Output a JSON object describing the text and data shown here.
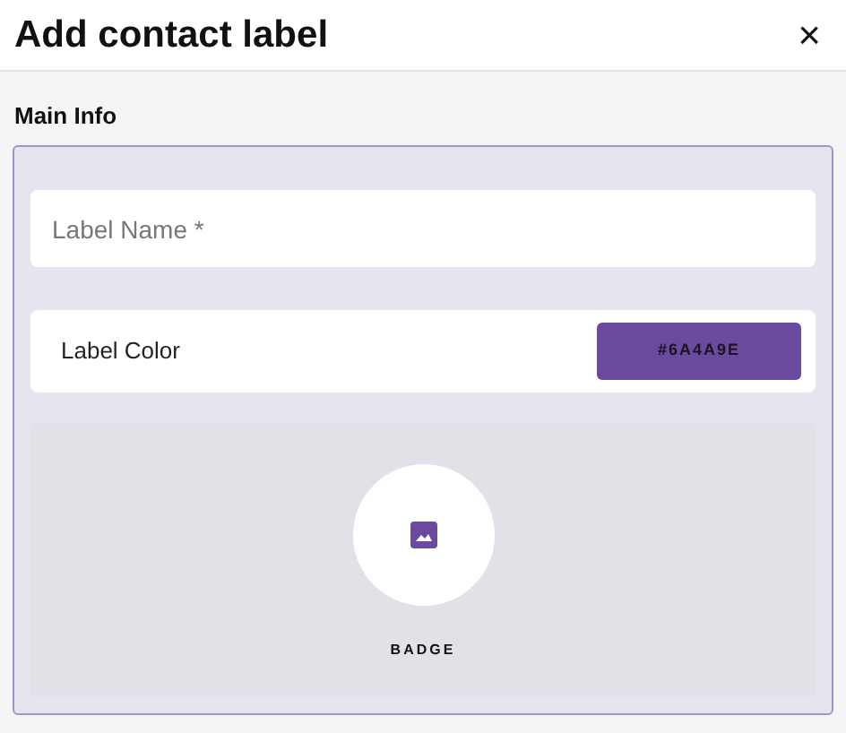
{
  "dialog": {
    "title": "Add contact label",
    "close": "×"
  },
  "section": {
    "title": "Main Info"
  },
  "label_name": {
    "placeholder": "Label Name *"
  },
  "label_color": {
    "label": "Label Color",
    "value": "#6A4A9E",
    "color": "#6a4a9e"
  },
  "badge": {
    "label": "BADGE"
  }
}
